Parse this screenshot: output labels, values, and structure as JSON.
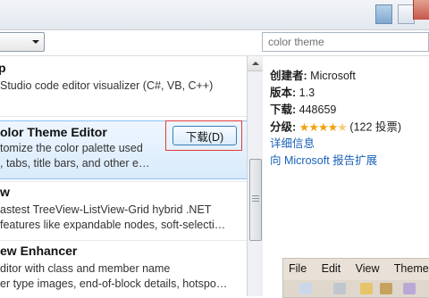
{
  "search": {
    "placeholder": "color theme"
  },
  "list": {
    "items": [
      {
        "title": "p",
        "desc": [
          "Studio code editor visualizer (C#, VB, C++)"
        ]
      },
      {
        "title": "olor Theme Editor",
        "desc": [
          "tomize the color palette used",
          ", tabs, title bars, and other e…"
        ],
        "button": "下载(D)"
      },
      {
        "title": "w",
        "desc": [
          "astest TreeView-ListView-Grid hybrid .NET",
          "features like expandable nodes, soft-selecti…"
        ]
      },
      {
        "title": "ew Enhancer",
        "desc": [
          "ditor with class and member name",
          "er type images, end-of-block details, hotspo…"
        ]
      }
    ]
  },
  "detail": {
    "creator_label": "创建者:",
    "creator_value": "Microsoft",
    "version_label": "版本:",
    "version_value": "1.3",
    "downloads_label": "下载:",
    "downloads_value": "448659",
    "rating_label": "分级:",
    "rating_stars": 4.5,
    "rating_count": "(122 投票)",
    "more_info_link": "详细信息",
    "report_link": "向 Microsoft 报告扩展"
  },
  "preview": {
    "menu": [
      "File",
      "Edit",
      "View",
      "Theme"
    ]
  },
  "colors": {
    "accent": "#1a62b7",
    "highlight": "#e23a3a",
    "star": "#f2a20c"
  }
}
